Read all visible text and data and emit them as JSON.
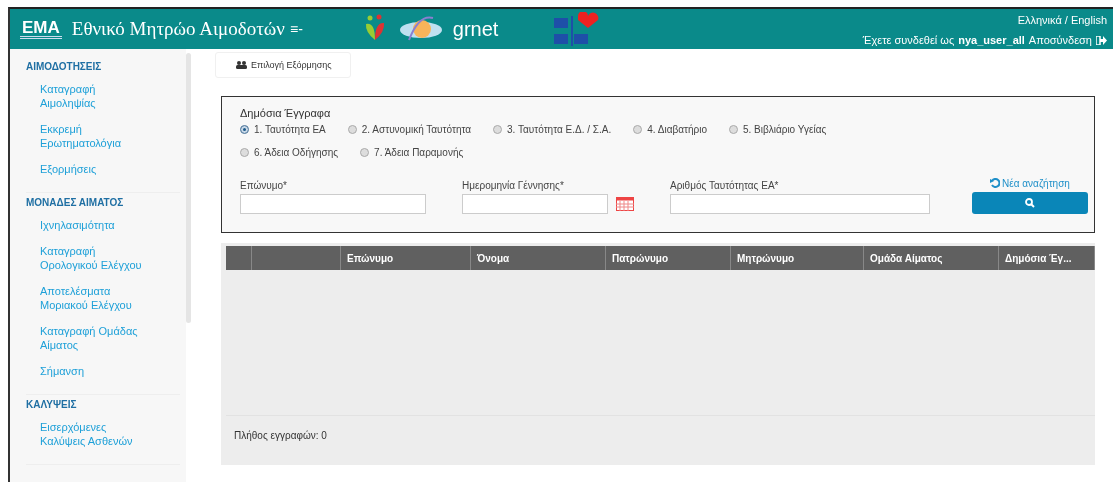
{
  "header": {
    "logo": "EMA",
    "title": "Εθνικό Μητρώο Αιμοδοτών",
    "menu_glyph": "≡-",
    "partner_logo": "grnet",
    "language": "Ελληνικά / English",
    "logged_in_as": "Έχετε συνδεθεί ως",
    "user": "nya_user_all",
    "logout": "Αποσύνδεση"
  },
  "sidebar": [
    {
      "heading": "ΑΙΜΟΔΟΤΗΣΕΙΣ",
      "items": [
        "Καταγραφή Αιμοληψίας",
        "Εκκρεμή Ερωτηματολόγια",
        "Εξορμήσεις"
      ]
    },
    {
      "heading": "ΜΟΝΑΔΕΣ ΑΙΜΑΤΟΣ",
      "items": [
        "Ιχνηλασιμότητα",
        "Καταγραφή Ορολογικού Ελέγχου",
        "Αποτελέσματα Μοριακού Ελέγχου",
        "Καταγραφή Ομάδας Αίματος",
        "Σήμανση"
      ]
    },
    {
      "heading": "ΚΑΛΥΨΕΙΣ",
      "items": [
        "Εισερχόμενες Καλύψεις Ασθενών"
      ]
    }
  ],
  "tab": {
    "label": "Επιλογή Εξόρμησης"
  },
  "form": {
    "group_label": "Δημόσια Έγγραφα",
    "documents": [
      {
        "label": "1. Ταυτότητα ΕΑ",
        "selected": true
      },
      {
        "label": "2. Αστυνομική Ταυτότητα",
        "selected": false
      },
      {
        "label": "3. Ταυτότητα Ε.Δ. / Σ.Α.",
        "selected": false
      },
      {
        "label": "4. Διαβατήριο",
        "selected": false
      },
      {
        "label": "5. Βιβλιάριο Υγείας",
        "selected": false
      },
      {
        "label": "6. Άδεια Οδήγησης",
        "selected": false
      },
      {
        "label": "7. Άδεια Παραμονής",
        "selected": false
      }
    ],
    "fields": [
      {
        "label": "Επώνυμο*",
        "kind": "text"
      },
      {
        "label": "Ημερομηνία Γέννησης*",
        "kind": "date"
      },
      {
        "label": "Αριθμός Ταυτότητας ΕΑ*",
        "kind": "text"
      }
    ],
    "new_search": "Νέα αναζήτηση"
  },
  "table": {
    "columns": [
      "Επώνυμο",
      "Όνομα",
      "Πατρώνυμο",
      "Μητρώνυμο",
      "Ομάδα Αίματος",
      "Δημόσια Έγ..."
    ],
    "footer": "Πλήθος εγγραφών: 0"
  }
}
